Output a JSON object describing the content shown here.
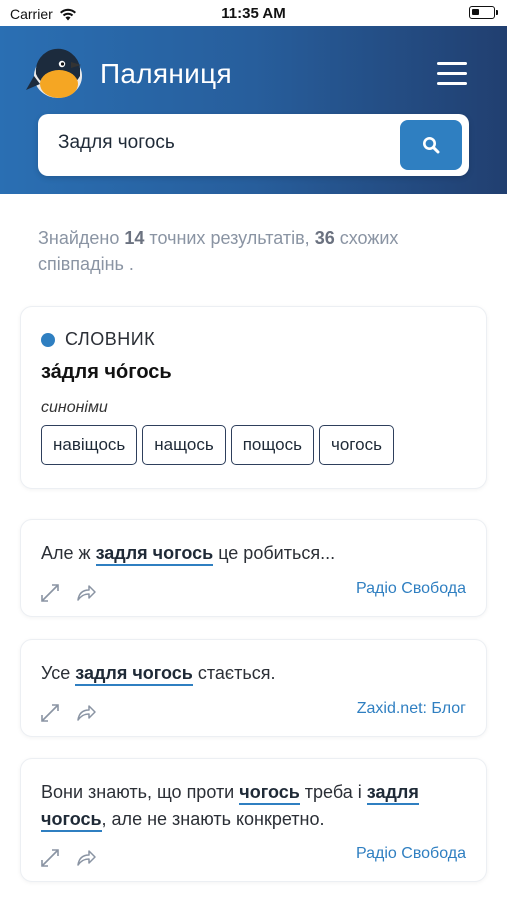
{
  "status_bar": {
    "carrier": "Carrier",
    "time": "11:35 AM"
  },
  "header": {
    "title": "Паляниця"
  },
  "search": {
    "value": "Задля чогось"
  },
  "summary": {
    "prefix": "Знайдено",
    "exact_count": "14",
    "exact_text": "точних результатів,",
    "similar_count": "36",
    "similar_text": "схожих співпадінь ."
  },
  "dictionary": {
    "label": "СЛОВНИК",
    "word": "за́для чо́гось",
    "synonyms_label": "синоніми",
    "synonyms": [
      "навіщось",
      "нащось",
      "пощось",
      "чогось"
    ]
  },
  "examples": [
    {
      "before": "Але ж ",
      "highlight": "задля чогось",
      "after": " це робиться...",
      "source": "Радіо Свобода"
    },
    {
      "before": "Усе ",
      "highlight": "задля чогось",
      "after": " стається.",
      "source": "Zaxid.net: Блог"
    },
    {
      "part1": "Вони знають, що проти ",
      "hl1": "чогось",
      "part2": " треба і ",
      "hl2": "задля",
      "hl3": "чогось",
      "part3": ", але не знають конкретно.",
      "source": "Радіо Свобода"
    }
  ],
  "colors": {
    "header_start": "#2a6fb3",
    "header_end": "#213f70",
    "accent": "#2f7fc1"
  },
  "icons": [
    "wifi-icon",
    "battery-icon",
    "bird-logo-icon",
    "hamburger-menu-icon",
    "search-icon",
    "expand-icon",
    "share-icon"
  ]
}
